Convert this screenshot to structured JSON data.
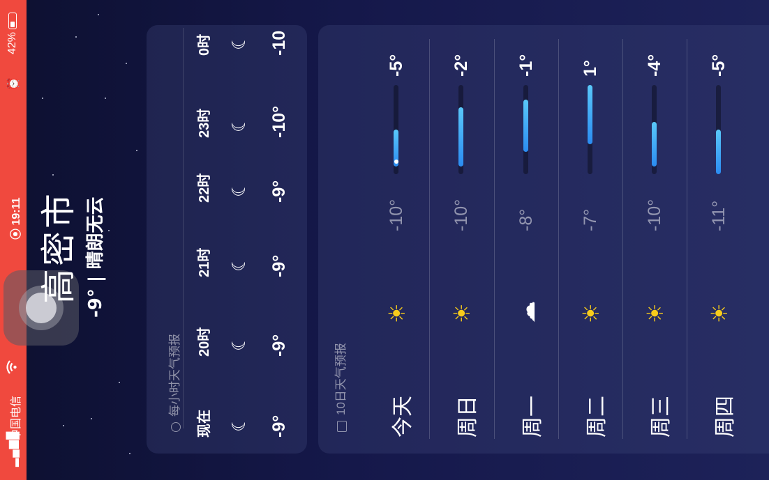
{
  "status_bar": {
    "carrier": "中国电信",
    "time": "19:11",
    "battery": "42%",
    "wifi_icon": "wifi-icon",
    "lock_icon": "orientation-lock-icon",
    "alarm_icon": "alarm-icon",
    "background_color": "#f0493e"
  },
  "header": {
    "city": "高密市",
    "summary": "-9°  |  晴朗无云"
  },
  "hourly": {
    "title": "每小时天气预报",
    "icon": "clock-icon",
    "items": [
      {
        "time": "现在",
        "icon": "moon-stars-icon",
        "temp": "-9°"
      },
      {
        "time": "20时",
        "icon": "moon-stars-icon",
        "temp": "-9°"
      },
      {
        "time": "21时",
        "icon": "moon-stars-icon",
        "temp": "-9°"
      },
      {
        "time": "22时",
        "icon": "moon-stars-icon",
        "temp": "-9°"
      },
      {
        "time": "23时",
        "icon": "moon-stars-icon",
        "temp": "-10°"
      },
      {
        "time": "0时",
        "icon": "moon-stars-icon",
        "temp": "-10"
      }
    ]
  },
  "daily": {
    "title": "10日天气预报",
    "icon": "calendar-icon",
    "range": [
      -11,
      1
    ],
    "items": [
      {
        "day": "今天",
        "icon": "sun-icon",
        "low": "-10°",
        "high": "-5°",
        "low_val": -10,
        "high_val": -5,
        "show_now": true
      },
      {
        "day": "周日",
        "icon": "sun-icon",
        "low": "-10°",
        "high": "-2°",
        "low_val": -10,
        "high_val": -2
      },
      {
        "day": "周一",
        "icon": "cloud-icon",
        "low": "-8°",
        "high": "-1°",
        "low_val": -8,
        "high_val": -1
      },
      {
        "day": "周二",
        "icon": "sun-icon",
        "low": "-7°",
        "high": "1°",
        "low_val": -7,
        "high_val": 1
      },
      {
        "day": "周三",
        "icon": "sun-icon",
        "low": "-10°",
        "high": "-4°",
        "low_val": -10,
        "high_val": -4
      },
      {
        "day": "周四",
        "icon": "sun-icon",
        "low": "-11°",
        "high": "-5°",
        "low_val": -11,
        "high_val": -5
      }
    ]
  }
}
